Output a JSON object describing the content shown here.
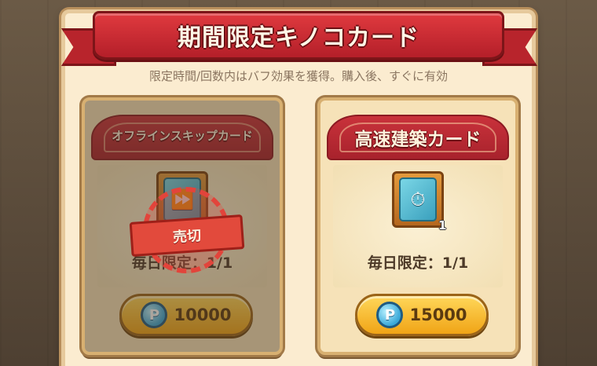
{
  "header": {
    "title": "期間限定キノコカード",
    "subtitle": "限定時間/回数内はバフ効果を獲得。購入後、すぐに有効"
  },
  "cards": [
    {
      "title": "オフラインスキップカード",
      "limit_text": "毎日限定：1/1",
      "price": "10000",
      "sold_out_label": "売切",
      "sold_out": true,
      "icon": "offline-skip-card-icon"
    },
    {
      "title": "高速建築カード",
      "limit_text": "毎日限定：1/1",
      "price": "15000",
      "quantity": "1",
      "sold_out": false,
      "icon": "fast-build-card-icon"
    }
  ],
  "currency": {
    "symbol": "P",
    "icon": "p-coin-icon"
  },
  "colors": {
    "ribbon": "#c0282f",
    "panel": "#fbecd0",
    "button": "#f5b52a",
    "stamp": "#e24a3c"
  }
}
